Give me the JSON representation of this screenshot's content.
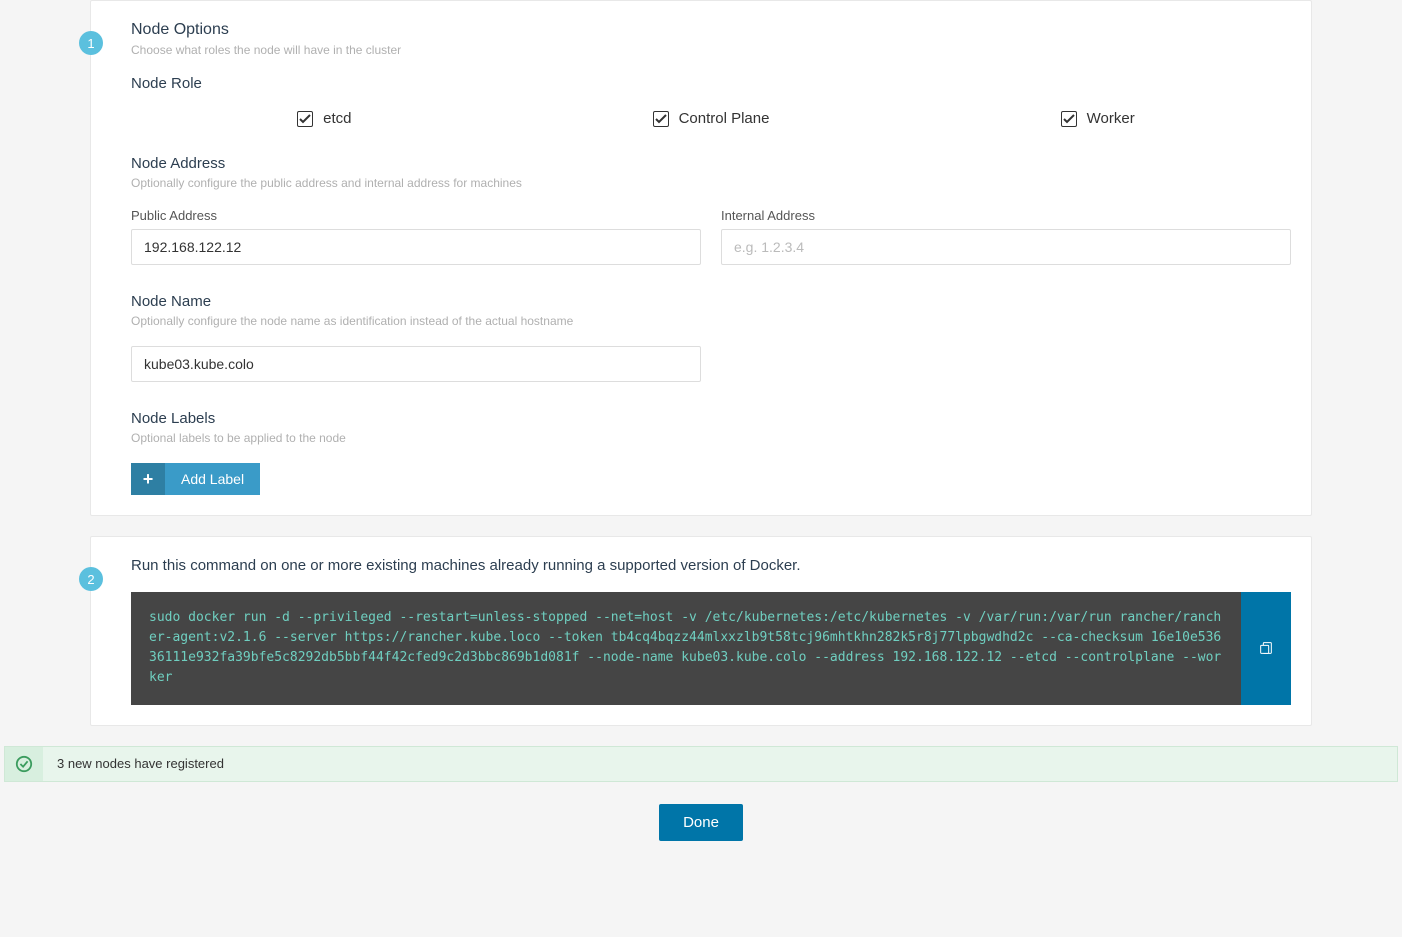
{
  "step1": {
    "badge": "1",
    "title": "Node Options",
    "desc": "Choose what roles the node will have in the cluster",
    "role": {
      "title": "Node Role",
      "etcd": "etcd",
      "controlplane": "Control Plane",
      "worker": "Worker"
    },
    "address": {
      "title": "Node Address",
      "desc": "Optionally configure the public address and internal address for machines",
      "public_label": "Public Address",
      "public_value": "192.168.122.12",
      "internal_label": "Internal Address",
      "internal_placeholder": "e.g. 1.2.3.4"
    },
    "name": {
      "title": "Node Name",
      "desc": "Optionally configure the node name as identification instead of the actual hostname",
      "value": "kube03.kube.colo"
    },
    "labels": {
      "title": "Node Labels",
      "desc": "Optional labels to be applied to the node",
      "add_btn": "Add Label"
    }
  },
  "step2": {
    "badge": "2",
    "desc": "Run this command on one or more existing machines already running a supported version of Docker.",
    "command": "sudo docker run -d --privileged --restart=unless-stopped --net=host -v /etc/kubernetes:/etc/kubernetes -v /var/run:/var/run rancher/rancher-agent:v2.1.6 --server https://rancher.kube.loco --token tb4cq4bqzz44mlxxzlb9t58tcj96mhtkhn282k5r8j77lpbgwdhd2c --ca-checksum 16e10e53636111e932fa39bfe5c8292db5bbf44f42cfed9c2d3bbc869b1d081f --node-name kube03.kube.colo --address 192.168.122.12 --etcd --controlplane --worker"
  },
  "banner": {
    "text": "3 new nodes have registered"
  },
  "done": "Done"
}
